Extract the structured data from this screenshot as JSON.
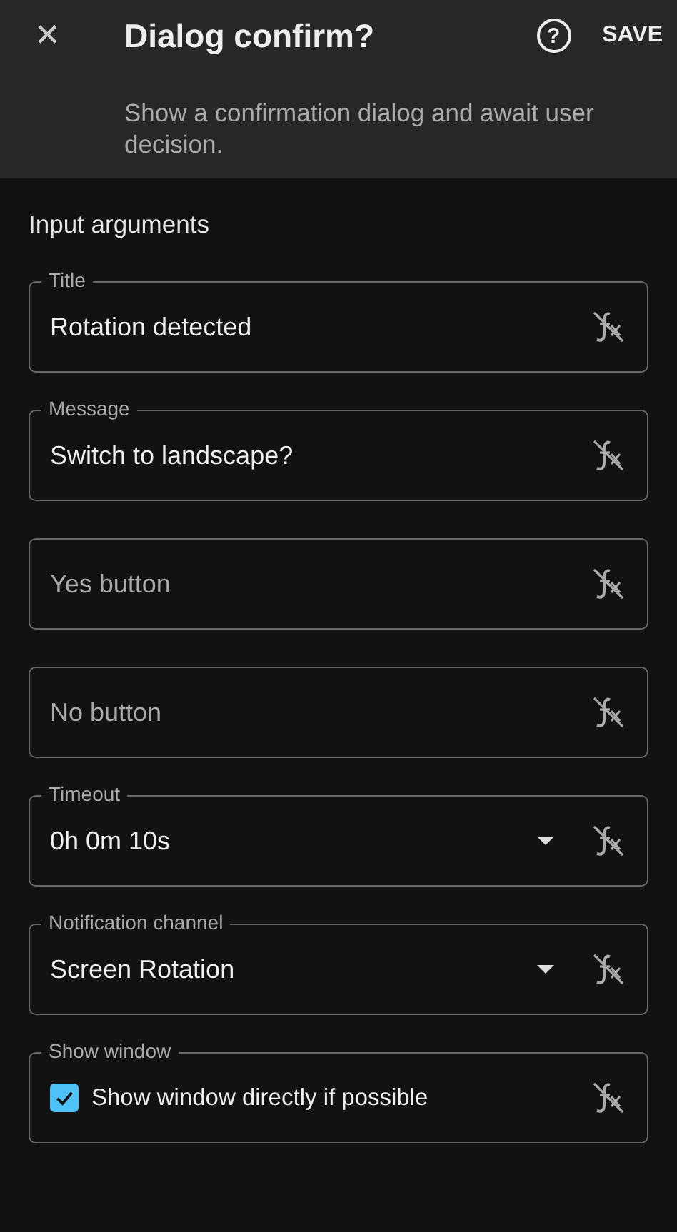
{
  "header": {
    "close": "✕",
    "title": "Dialog confirm?",
    "help": "?",
    "save": "SAVE",
    "description": "Show a confirmation dialog and await user decision."
  },
  "section_title": "Input arguments",
  "fields": [
    {
      "kind": "text",
      "label": "Title",
      "value": "Rotation detected"
    },
    {
      "kind": "text",
      "label": "Message",
      "value": "Switch to landscape?"
    },
    {
      "kind": "text",
      "placeholder": "Yes button"
    },
    {
      "kind": "text",
      "placeholder": "No button"
    },
    {
      "kind": "dropdown",
      "label": "Timeout",
      "value": "0h 0m 10s"
    },
    {
      "kind": "dropdown",
      "label": "Notification channel",
      "value": "Screen Rotation"
    },
    {
      "kind": "checkbox",
      "label": "Show window",
      "text": "Show window directly if possible",
      "checked": true
    }
  ]
}
